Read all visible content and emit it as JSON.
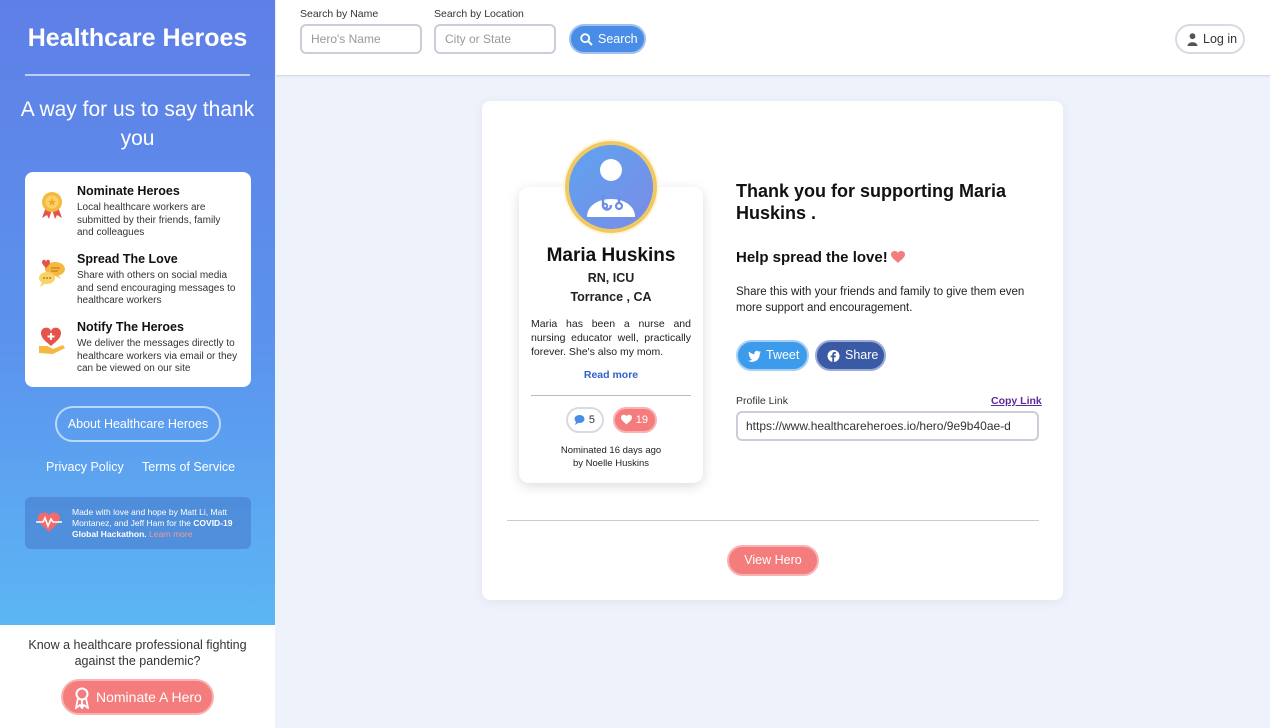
{
  "sidebar": {
    "brand": "Healthcare Heroes",
    "tagline": "A way for us to say thank you",
    "features": [
      {
        "title": "Nominate Heroes",
        "desc": "Local healthcare workers are submitted by their friends, family and colleagues",
        "icon": "award-ribbon-icon"
      },
      {
        "title": "Spread The Love",
        "desc": "Share with others on social media and send encouraging messages to healthcare workers",
        "icon": "chat-bubbles-icon"
      },
      {
        "title": "Notify The Heroes",
        "desc": "We deliver the messages directly to healthcare workers via email or they can be viewed on our site",
        "icon": "heart-hand-icon"
      }
    ],
    "about_label": "About Healthcare Heroes",
    "privacy_label": "Privacy Policy",
    "terms_label": "Terms of Service",
    "made_by": {
      "text": "Made with love and hope by Matt Li, Matt Montanez, and Jeff Ham for the ",
      "event": "COVID-19 Global Hackathon.",
      "learn_more": "Learn more"
    },
    "cta_question": "Know a healthcare professional fighting against the pandemic?",
    "nominate_label": "Nominate A Hero"
  },
  "search": {
    "name_label": "Search by Name",
    "name_placeholder": "Hero's Name",
    "location_label": "Search by Location",
    "location_placeholder": "City or State",
    "button_label": "Search"
  },
  "auth": {
    "login_label": "Log in"
  },
  "hero": {
    "name": "Maria Huskins",
    "role": "RN, ICU",
    "location": "Torrance , CA",
    "bio": "Maria has been a nurse and nursing educator well, practically forever. She's also my mom.",
    "read_more": "Read more",
    "comments": "5",
    "likes": "19",
    "nominated_when": "Nominated 16 days ago",
    "nominated_by": "by Noelle Huskins"
  },
  "share": {
    "thanks": "Thank you for supporting Maria Huskins .",
    "spread": "Help spread the love!",
    "description": "Share this with your friends and family to give them even more support and encouragement.",
    "tweet_label": "Tweet",
    "share_label": "Share",
    "profile_label": "Profile Link",
    "copy_label": "Copy Link",
    "profile_url": "https://www.healthcareheroes.io/hero/9e9b40ae-d",
    "view_hero_label": "View Hero"
  },
  "colors": {
    "accent_blue": "#4a8de6",
    "accent_coral": "#f47c7c",
    "twitter": "#3d9bec",
    "facebook": "#3b5aa6"
  }
}
